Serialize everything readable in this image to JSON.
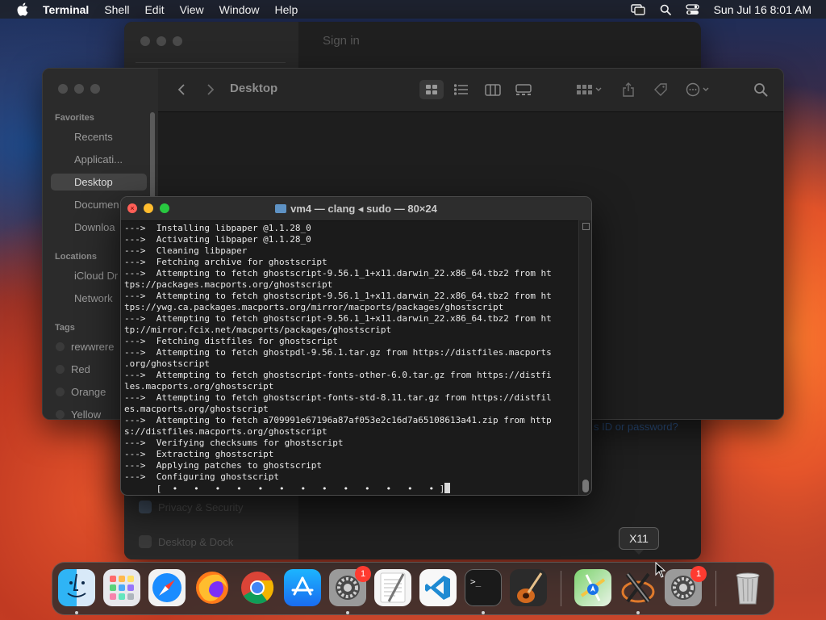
{
  "menubar": {
    "app": "Terminal",
    "items": [
      "Shell",
      "Edit",
      "View",
      "Window",
      "Help"
    ],
    "clock": "Sun Jul 16  8:01 AM"
  },
  "settings_window": {
    "signin": "Sign in",
    "sidebar": [
      "Privacy & Security",
      "Desktop & Dock"
    ],
    "link": "s ID or password?"
  },
  "finder": {
    "title": "Desktop",
    "favorites_header": "Favorites",
    "favorites": [
      "Recents",
      "Applicati...",
      "Desktop",
      "Documen",
      "Downloa"
    ],
    "locations_header": "Locations",
    "locations": [
      "iCloud Dr",
      "Network"
    ],
    "tags_header": "Tags",
    "tags": [
      {
        "label": "rewwrere",
        "color": "#3a3a3a"
      },
      {
        "label": "Red",
        "color": "#3a3a3a"
      },
      {
        "label": "Orange",
        "color": "#3a3a3a"
      },
      {
        "label": "Yellow",
        "color": "#3a3a3a"
      }
    ]
  },
  "terminal": {
    "title": "vm4 — clang ◂ sudo — 80×24",
    "lines": [
      "--->  Installing libpaper @1.1.28_0",
      "--->  Activating libpaper @1.1.28_0",
      "--->  Cleaning libpaper",
      "--->  Fetching archive for ghostscript",
      "--->  Attempting to fetch ghostscript-9.56.1_1+x11.darwin_22.x86_64.tbz2 from ht",
      "tps://packages.macports.org/ghostscript",
      "--->  Attempting to fetch ghostscript-9.56.1_1+x11.darwin_22.x86_64.tbz2 from ht",
      "tps://ywg.ca.packages.macports.org/mirror/macports/packages/ghostscript",
      "--->  Attempting to fetch ghostscript-9.56.1_1+x11.darwin_22.x86_64.tbz2 from ht",
      "tp://mirror.fcix.net/macports/packages/ghostscript",
      "--->  Fetching distfiles for ghostscript",
      "--->  Attempting to fetch ghostpdl-9.56.1.tar.gz from https://distfiles.macports",
      ".org/ghostscript",
      "--->  Attempting to fetch ghostscript-fonts-other-6.0.tar.gz from https://distfi",
      "les.macports.org/ghostscript",
      "--->  Attempting to fetch ghostscript-fonts-std-8.11.tar.gz from https://distfil",
      "es.macports.org/ghostscript",
      "--->  Attempting to fetch a709991e67196a87af053e2c16d7a65108613a41.zip from http",
      "s://distfiles.macports.org/ghostscript",
      "--->  Verifying checksums for ghostscript",
      "--->  Extracting ghostscript",
      "--->  Applying patches to ghostscript",
      "--->  Configuring ghostscript"
    ],
    "progress": "      [  •   •   •   •   •   •   •   •   •   •   •   •   • ]"
  },
  "dock": {
    "tooltip": "X11",
    "badges": [
      "1",
      "1"
    ]
  }
}
